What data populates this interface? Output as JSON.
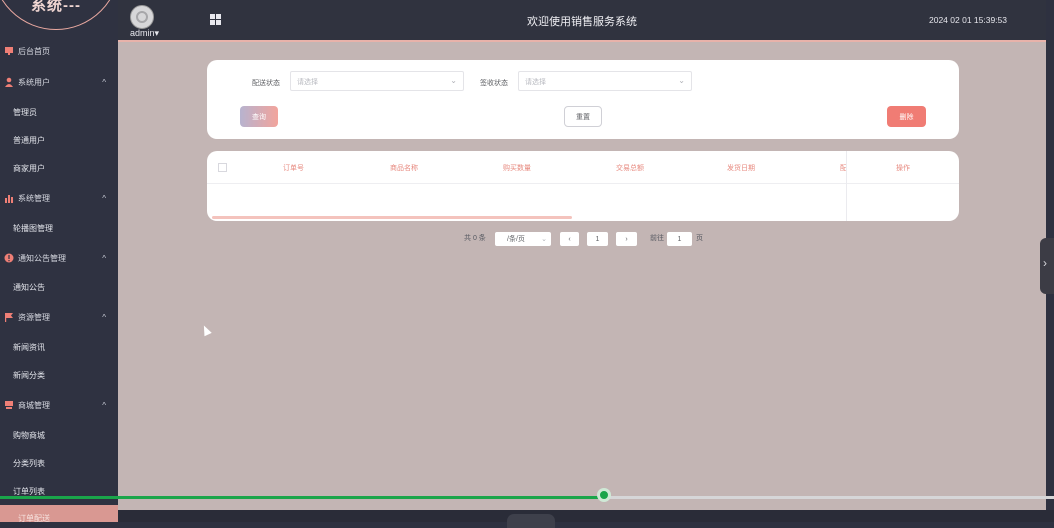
{
  "app": {
    "logo_text": "系统---",
    "title": "欢迎使用销售服务系统",
    "datetime": "2024 02 01 15:39:53",
    "user": "admin",
    "user_caret": "▾"
  },
  "sidebar": {
    "items": [
      {
        "label": "后台首页",
        "icon": "monitor-icon"
      },
      {
        "label": "系统用户",
        "icon": "user-icon",
        "chevron": "^"
      },
      {
        "label": "管理员"
      },
      {
        "label": "普通用户"
      },
      {
        "label": "商家用户"
      },
      {
        "label": "系统管理",
        "icon": "bar-chart-icon",
        "chevron": "^"
      },
      {
        "label": "轮播图管理"
      },
      {
        "label": "通知公告管理",
        "icon": "info-icon",
        "chevron": "^"
      },
      {
        "label": "通知公告"
      },
      {
        "label": "资源管理",
        "icon": "flag-icon",
        "chevron": "^"
      },
      {
        "label": "新闻资讯"
      },
      {
        "label": "新闻分类"
      },
      {
        "label": "商城管理",
        "icon": "store-icon",
        "chevron": "^"
      },
      {
        "label": "购物商城"
      },
      {
        "label": "分类列表"
      },
      {
        "label": "订单列表"
      },
      {
        "label": "订单配送"
      }
    ]
  },
  "filters": {
    "delivery_status_label": "配送状态",
    "delivery_status_placeholder": "请选择",
    "receipt_status_label": "签收状态",
    "receipt_status_placeholder": "请选择",
    "query_button": "查询",
    "reset_button": "重置",
    "delete_button": "删除"
  },
  "table": {
    "columns": [
      "订单号",
      "商品名称",
      "购买数量",
      "交易总额",
      "发货日期",
      "配",
      "操作"
    ],
    "rows": []
  },
  "pagination": {
    "total_text": "共 0 条",
    "page_size": "/条/页",
    "prev": "‹",
    "current_page": "1",
    "next": "›",
    "goto_label": "前往",
    "goto_value": "1",
    "page_unit": "页"
  },
  "colors": {
    "accent": "#f07c74",
    "sidebar_bg": "#2f3241",
    "main_bg": "#c3b5b4",
    "progress": "#1aa54a"
  },
  "media": {
    "progress_fraction": 0.574
  }
}
